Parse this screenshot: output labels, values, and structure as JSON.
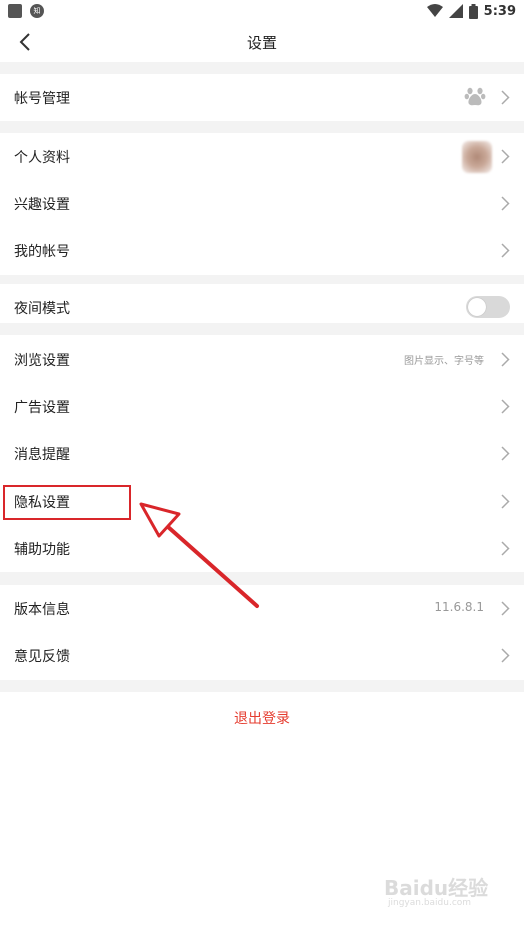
{
  "status_bar": {
    "app_badge": "知",
    "time": "5:39"
  },
  "header": {
    "title": "设置"
  },
  "sections": {
    "account": {
      "label": "帐号管理"
    },
    "profile": {
      "label": "个人资料"
    },
    "interest": {
      "label": "兴趣设置"
    },
    "my_account": {
      "label": "我的帐号"
    },
    "night_mode": {
      "label": "夜间模式",
      "enabled": false
    },
    "browse": {
      "label": "浏览设置",
      "meta": "图片显示、字号等"
    },
    "ads": {
      "label": "广告设置"
    },
    "notify": {
      "label": "消息提醒"
    },
    "privacy": {
      "label": "隐私设置"
    },
    "accessibility": {
      "label": "辅助功能"
    },
    "version": {
      "label": "版本信息",
      "meta": "11.6.8.1"
    },
    "feedback": {
      "label": "意见反馈"
    }
  },
  "logout_label": "退出登录",
  "colors": {
    "accent_red": "#e53c2f",
    "annotation_red": "#d9262a",
    "divider_gray": "#f3f3f3"
  },
  "watermark": {
    "logo_text": "Baidu经验",
    "url": "jingyan.baidu.com"
  }
}
